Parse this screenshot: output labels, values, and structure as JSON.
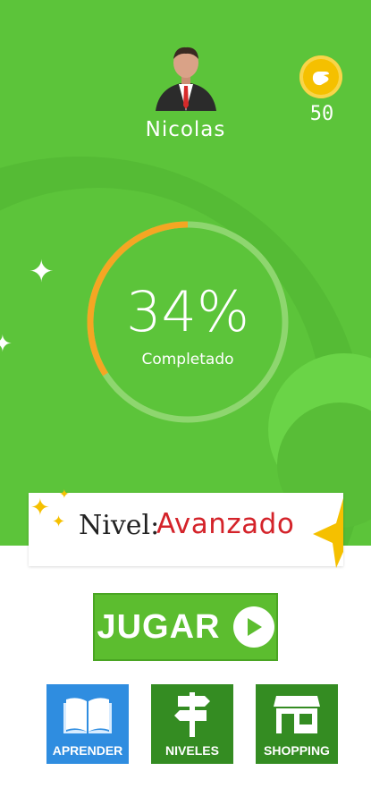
{
  "user": {
    "name": "Nicolas",
    "coins": "50"
  },
  "progress": {
    "percent": 34,
    "display": "34%",
    "label": "Completado"
  },
  "level": {
    "label": "Nivel:",
    "value": "Avanzado"
  },
  "actions": {
    "play_label": "JUGAR"
  },
  "menu": [
    {
      "label": "APRENDER",
      "icon": "book-icon",
      "color": "#2f8de0"
    },
    {
      "label": "NIVELES",
      "icon": "signpost-icon",
      "color": "#348c22"
    },
    {
      "label": "SHOPPING",
      "icon": "store-icon",
      "color": "#348c22"
    }
  ],
  "colors": {
    "background": "#5cc43a",
    "progress_track": "#8ed66f",
    "progress_fill": "#f5a623",
    "level_text": "#d4232a",
    "coin": "#f5c000"
  }
}
